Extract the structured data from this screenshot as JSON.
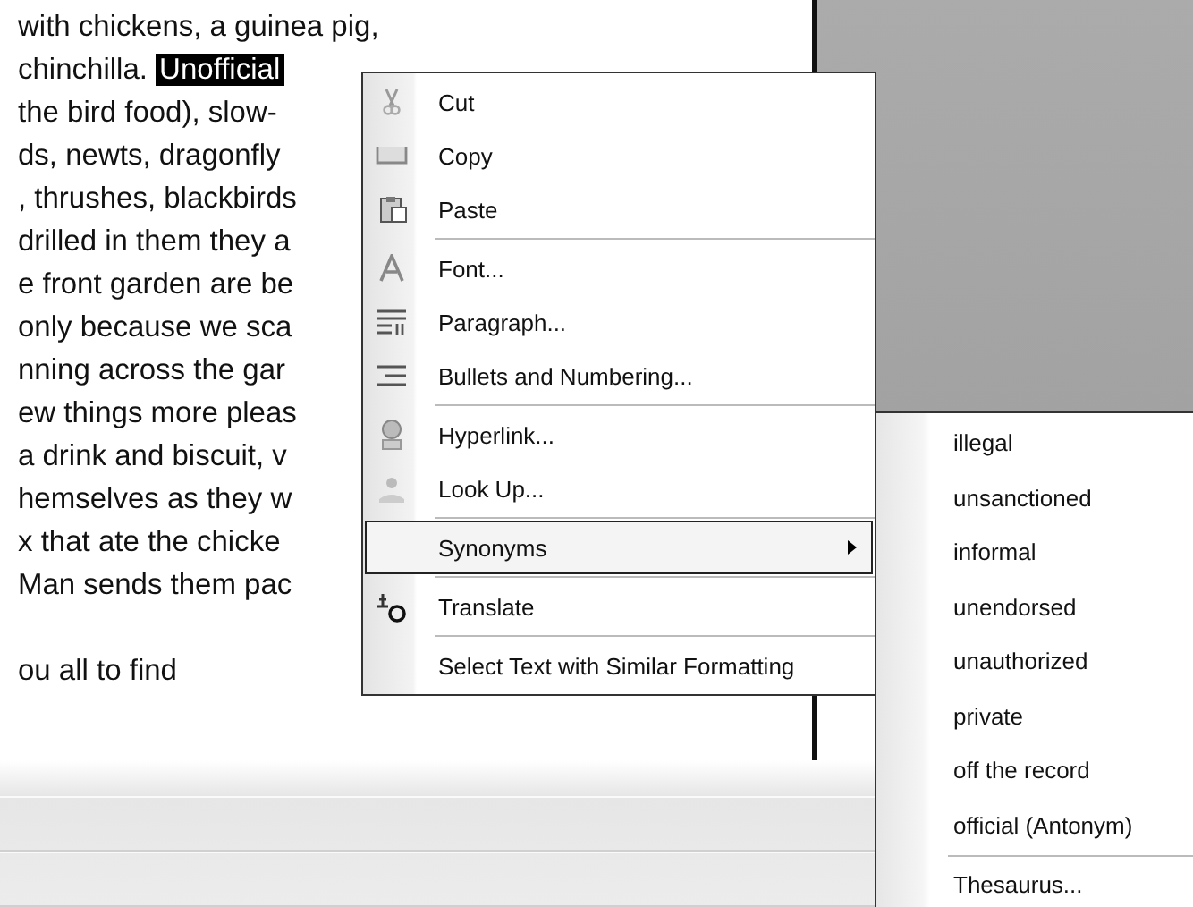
{
  "document": {
    "lines": [
      {
        "space_before": false,
        "segments": [
          {
            "text": "with chickens, a guinea pig,",
            "selected": false
          }
        ]
      },
      {
        "space_before": false,
        "segments": [
          {
            "text": "chinchilla. ",
            "selected": false
          },
          {
            "text": "Unofficial",
            "selected": true
          }
        ]
      },
      {
        "space_before": false,
        "segments": [
          {
            "text": "the bird food), slow-",
            "selected": false
          }
        ]
      },
      {
        "space_before": false,
        "segments": [
          {
            "text": "ds, newts, dragonfly",
            "selected": false
          }
        ]
      },
      {
        "space_before": false,
        "segments": [
          {
            "text": ", thrushes, blackbirds",
            "selected": false
          }
        ]
      },
      {
        "space_before": false,
        "segments": [
          {
            "text": "drilled in them they a",
            "selected": false
          }
        ]
      },
      {
        "space_before": false,
        "segments": [
          {
            "text": "e front garden are be",
            "selected": false
          }
        ]
      },
      {
        "space_before": false,
        "segments": [
          {
            "text": "only because we sca",
            "selected": false
          }
        ]
      },
      {
        "space_before": false,
        "segments": [
          {
            "text": "nning across the gar",
            "selected": false
          }
        ]
      },
      {
        "space_before": false,
        "segments": [
          {
            "text": "ew things more pleas",
            "selected": false
          }
        ]
      },
      {
        "space_before": false,
        "segments": [
          {
            "text": "a drink and biscuit, v",
            "selected": false
          }
        ]
      },
      {
        "space_before": false,
        "segments": [
          {
            "text": "hemselves as they w",
            "selected": false
          }
        ]
      },
      {
        "space_before": false,
        "segments": [
          {
            "text": "x that ate the chicke",
            "selected": false
          }
        ]
      },
      {
        "space_before": false,
        "segments": [
          {
            "text": "Man sends them pac",
            "selected": false
          }
        ]
      },
      {
        "space_before": true,
        "segments": [
          {
            "text": "ou all to find",
            "selected": false
          }
        ]
      }
    ]
  },
  "context_menu": {
    "groups": [
      [
        {
          "label": "Cut",
          "selected": false,
          "submenu": false
        },
        {
          "label": "Copy",
          "selected": false,
          "submenu": false
        },
        {
          "label": "Paste",
          "selected": false,
          "submenu": false
        }
      ],
      [
        {
          "label": "Font...",
          "selected": false,
          "submenu": false
        },
        {
          "label": "Paragraph...",
          "selected": false,
          "submenu": false
        },
        {
          "label": "Bullets and Numbering...",
          "selected": false,
          "submenu": false
        }
      ],
      [
        {
          "label": "Hyperlink...",
          "selected": false,
          "submenu": false
        },
        {
          "label": "Look Up...",
          "selected": false,
          "submenu": false
        }
      ],
      [
        {
          "label": "Synonyms",
          "selected": true,
          "submenu": true
        }
      ],
      [
        {
          "label": "Translate",
          "selected": false,
          "submenu": false
        }
      ],
      [
        {
          "label": "Select Text with Similar Formatting",
          "selected": false,
          "submenu": false
        }
      ]
    ]
  },
  "synonyms_menu": {
    "groups": [
      [
        {
          "label": "illegal"
        },
        {
          "label": "unsanctioned"
        },
        {
          "label": "informal"
        },
        {
          "label": "unendorsed"
        },
        {
          "label": "unauthorized"
        },
        {
          "label": "private"
        },
        {
          "label": "off the record"
        },
        {
          "label": "official (Antonym)"
        }
      ],
      [
        {
          "label": "Thesaurus..."
        }
      ]
    ]
  }
}
